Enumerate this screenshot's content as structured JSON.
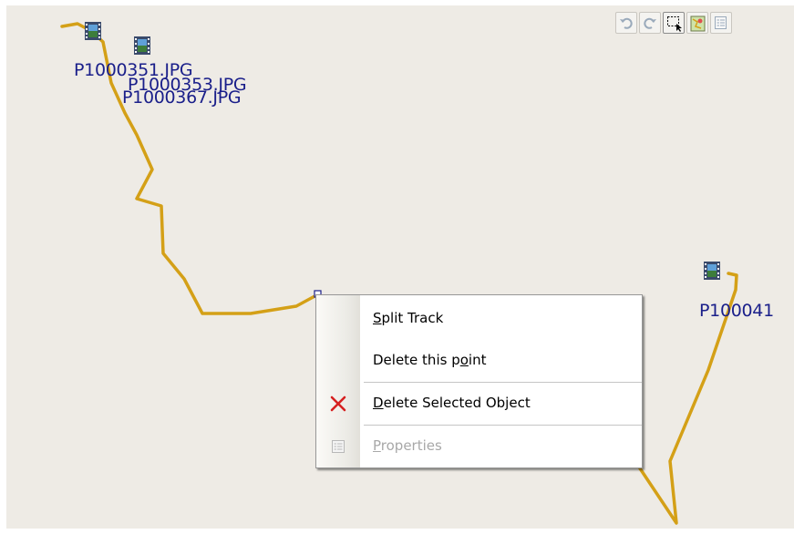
{
  "toolbar": {
    "buttons": [
      {
        "name": "undo",
        "icon": "undo-icon",
        "enabled": false
      },
      {
        "name": "redo",
        "icon": "redo-icon",
        "enabled": false
      },
      {
        "name": "select",
        "icon": "select-rectangle-icon",
        "enabled": true
      },
      {
        "name": "layers",
        "icon": "map-layers-icon",
        "enabled": true
      },
      {
        "name": "properties",
        "icon": "properties-icon",
        "enabled": false
      }
    ]
  },
  "photos": [
    {
      "label": "P1000351.JPG",
      "icon": "photo-film-icon"
    },
    {
      "label": "P1000353.JPG",
      "icon": "photo-film-icon"
    },
    {
      "label": "P1000367.JPG",
      "icon": "photo-film-icon"
    },
    {
      "label": "P100041",
      "icon": "photo-film-icon"
    }
  ],
  "track": {
    "color": "#d4a017"
  },
  "context_menu": {
    "items": [
      {
        "pre": "",
        "accel": "S",
        "post": "plit Track",
        "enabled": true,
        "icon": ""
      },
      {
        "pre": "Delete this p",
        "accel": "o",
        "post": "int",
        "enabled": true,
        "icon": ""
      },
      {
        "pre": "",
        "accel": "D",
        "post": "elete Selected Object",
        "enabled": true,
        "icon": "delete-x-icon"
      },
      {
        "pre": "",
        "accel": "P",
        "post": "roperties",
        "enabled": false,
        "icon": "properties-icon"
      }
    ]
  },
  "colors": {
    "map_background": "#eeebe5",
    "label_text": "#1a1f8a",
    "delete_x": "#d62020"
  }
}
